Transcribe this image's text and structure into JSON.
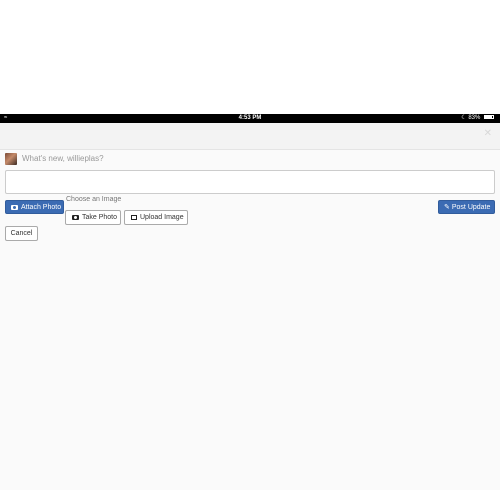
{
  "status_bar": {
    "time": "4:53 PM",
    "battery": "83%",
    "battery_level": 0.83,
    "wifi_icon": "wifi-icon",
    "moon_icon": "moon-icon"
  },
  "top_bar": {
    "close_icon": "close-icon"
  },
  "composer": {
    "prompt": "What's new, willieplas?",
    "input_value": ""
  },
  "actions": {
    "attach_label": "Attach Photo",
    "post_label": "Post Update",
    "choose_label": "Choose an Image",
    "take_label": "Take Photo",
    "upload_label": "Upload Image",
    "cancel_label": "Cancel"
  },
  "colors": {
    "primary": "#3b6bb3",
    "status_bar": "#000000",
    "background": "#fafafa"
  }
}
